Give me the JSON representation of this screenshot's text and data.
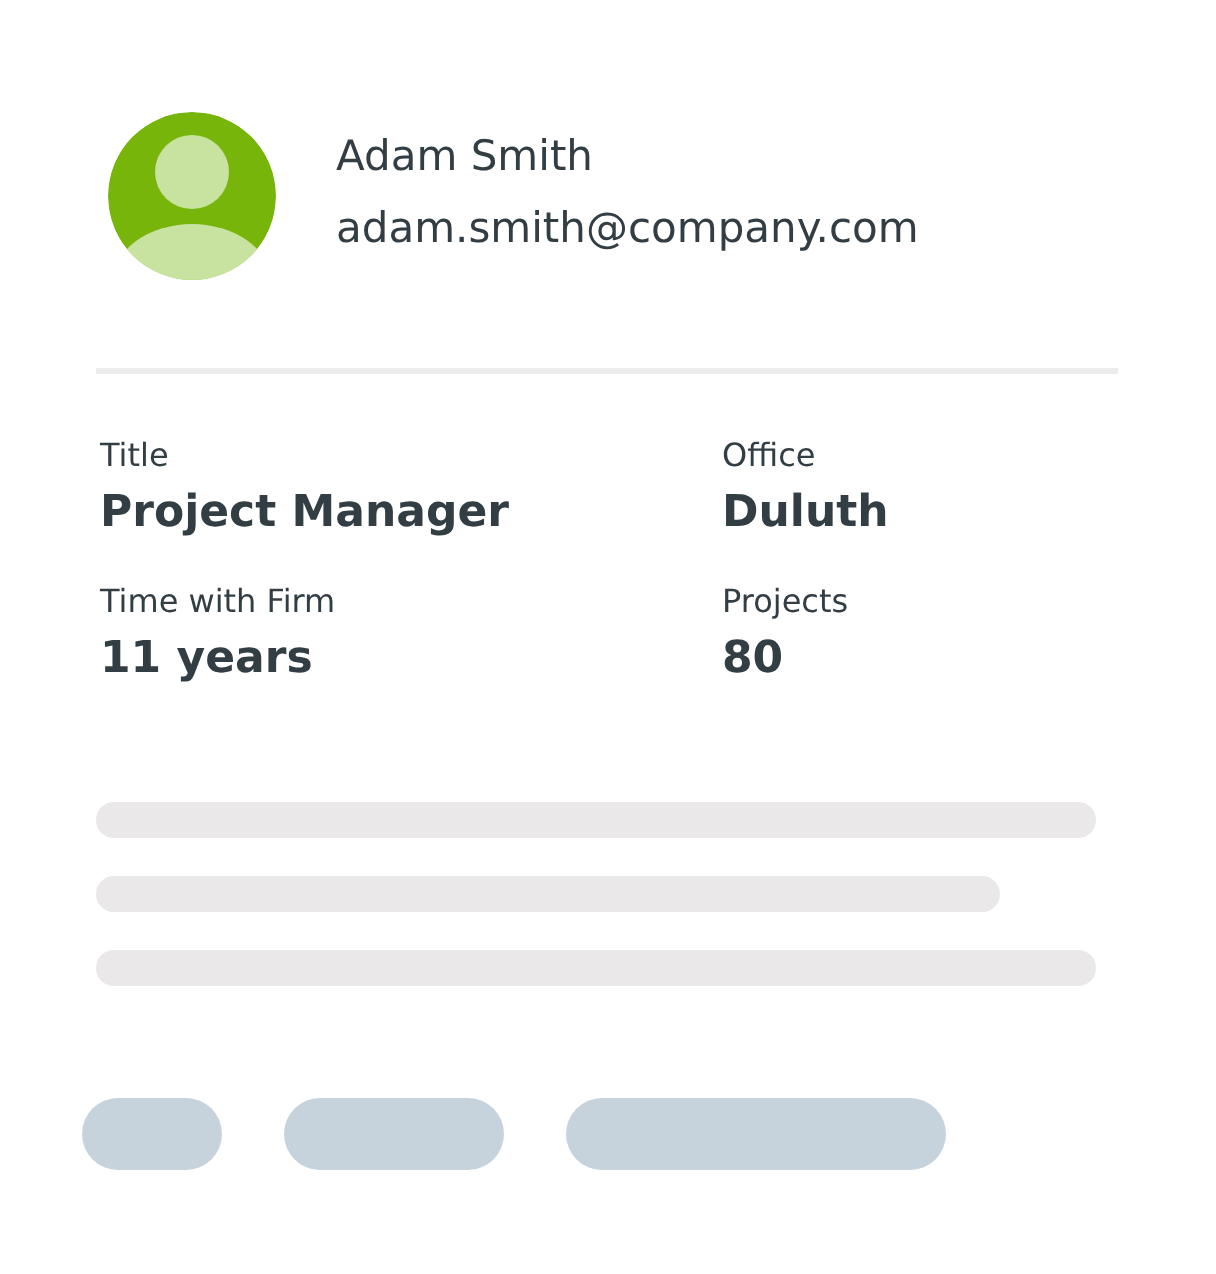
{
  "profile": {
    "name": "Adam Smith",
    "email": "adam.smith@company.com"
  },
  "fields": [
    {
      "label": "Title",
      "value": "Project Manager"
    },
    {
      "label": "Office",
      "value": "Duluth"
    },
    {
      "label": "Time with Firm",
      "value": "11 years"
    },
    {
      "label": "Projects",
      "value": "80"
    }
  ]
}
